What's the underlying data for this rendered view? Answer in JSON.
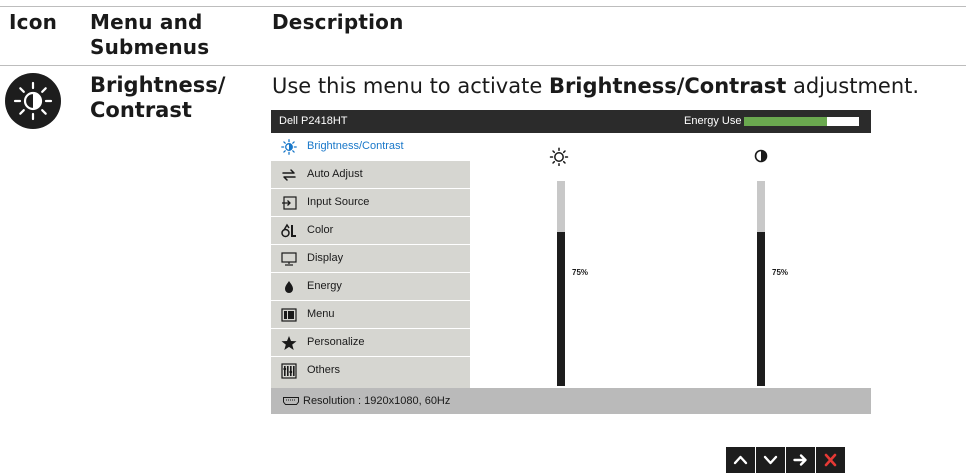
{
  "table": {
    "headers": {
      "icon": "Icon",
      "menu": "Menu and Submenus",
      "description": "Description"
    },
    "row": {
      "name": "Brightness/ Contrast",
      "desc_prefix": "Use this menu to activate ",
      "desc_bold": "Brightness/Contrast",
      "desc_suffix": " adjustment.",
      "icon": "brightness-icon"
    }
  },
  "osd": {
    "model": "Dell P2418HT",
    "energy_label": "Energy Use",
    "energy_level": 0.72,
    "energy_color": "#6aa84f",
    "accent": "#1877c9",
    "menu": [
      {
        "label": "Brightness/Contrast",
        "icon": "brightness-icon",
        "active": true
      },
      {
        "label": "Auto Adjust",
        "icon": "auto-adjust-icon"
      },
      {
        "label": "Input Source",
        "icon": "input-source-icon"
      },
      {
        "label": "Color",
        "icon": "color-icon"
      },
      {
        "label": "Display",
        "icon": "display-icon"
      },
      {
        "label": "Energy",
        "icon": "energy-icon"
      },
      {
        "label": "Menu",
        "icon": "menu-icon"
      },
      {
        "label": "Personalize",
        "icon": "star-icon"
      },
      {
        "label": "Others",
        "icon": "others-icon"
      }
    ],
    "brightness": {
      "icon": "sun-icon",
      "value": 75,
      "value_label": "75%"
    },
    "contrast": {
      "icon": "contrast-icon",
      "value": 75,
      "value_label": "75%"
    },
    "status": {
      "label": "Resolution : 1920x1080, 60Hz",
      "icon": "hdmi-port-icon"
    }
  },
  "nav_buttons": [
    {
      "name": "up-button",
      "icon": "chevron-up-icon"
    },
    {
      "name": "down-button",
      "icon": "chevron-down-icon"
    },
    {
      "name": "right-button",
      "icon": "arrow-right-icon"
    },
    {
      "name": "close-button",
      "icon": "close-icon",
      "color": "#e53935"
    }
  ]
}
